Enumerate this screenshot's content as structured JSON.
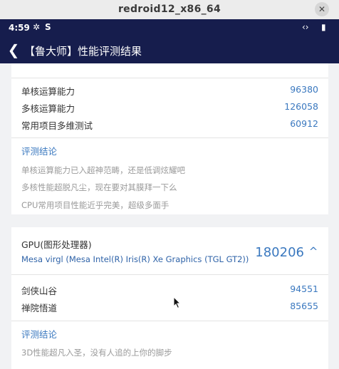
{
  "window": {
    "title": "redroid12_x86_64",
    "close_glyph": "✕"
  },
  "statusbar": {
    "time": "4:59",
    "icons": [
      "settings-gear-icon",
      "sync-icon",
      "data-transfer-icon",
      "battery-icon"
    ],
    "left_glyph_1": "✲",
    "left_glyph_2": "S",
    "right_glyph_1": "‹›",
    "right_glyph_2": "▮"
  },
  "appbar": {
    "back_glyph": "❮",
    "title": "【鲁大师】性能评测结果"
  },
  "cpu_card": {
    "rows": [
      {
        "label": "单核运算能力",
        "value": "96380"
      },
      {
        "label": "多核运算能力",
        "value": "126058"
      },
      {
        "label": "常用项目多维测试",
        "value": "60912"
      }
    ],
    "conclusion_title": "评测结论",
    "remarks": [
      "单核运算能力已入超神范畴，还是低调炫耀吧",
      "多核性能超脱凡尘，现在要对其膜拜一下么",
      "CPU常用项目性能近乎完美，超级多面手"
    ]
  },
  "gpu_card": {
    "heading": "GPU(图形处理器)",
    "model": "Mesa virgl (Mesa Intel(R) Iris(R) Xe Graphics (TGL GT2))",
    "score": "180206",
    "collapse_glyph": "^",
    "rows": [
      {
        "label": "剑侠山谷",
        "value": "94551"
      },
      {
        "label": "禅院悟道",
        "value": "85655"
      }
    ],
    "conclusion_title": "评测结论",
    "remarks": [
      "3D性能超凡入圣，没有人追的上你的脚步"
    ]
  },
  "colors": {
    "statusbar_bg": "#161d4d",
    "accent_blue": "#3a78bf",
    "remark_gray": "#9a9a9a"
  }
}
